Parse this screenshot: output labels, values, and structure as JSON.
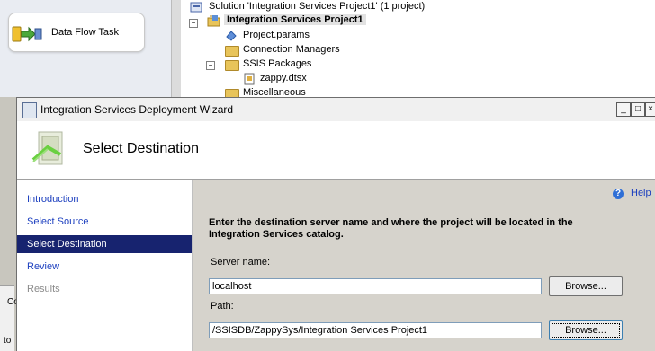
{
  "toolbox": {
    "item_label": "Data Flow Task"
  },
  "solution_explorer": {
    "solution_label": "Solution 'Integration Services Project1' (1 project)",
    "project_label": "Integration Services Project1",
    "items": [
      {
        "label": "Project.params"
      },
      {
        "label": "Connection Managers"
      },
      {
        "label": "SSIS Packages"
      },
      {
        "label": "zappy.dtsx"
      },
      {
        "label": "Miscellaneous"
      }
    ]
  },
  "left_strip": {
    "text_top": "Co",
    "text_bottom": "to"
  },
  "wizard": {
    "title": "Integration Services Deployment Wizard",
    "page_title": "Select Destination",
    "nav": [
      {
        "label": "Introduction",
        "state": "link"
      },
      {
        "label": "Select Source",
        "state": "link"
      },
      {
        "label": "Select Destination",
        "state": "selected"
      },
      {
        "label": "Review",
        "state": "link"
      },
      {
        "label": "Results",
        "state": "disabled"
      }
    ],
    "help_label": "Help",
    "instructions": "Enter the destination server name and where the project will be located in the Integration Services catalog.",
    "server_name_label": "Server name:",
    "server_name_value": "localhost",
    "path_label": "Path:",
    "path_value": "/SSISDB/ZappySys/Integration Services Project1",
    "browse_label": "Browse..."
  }
}
